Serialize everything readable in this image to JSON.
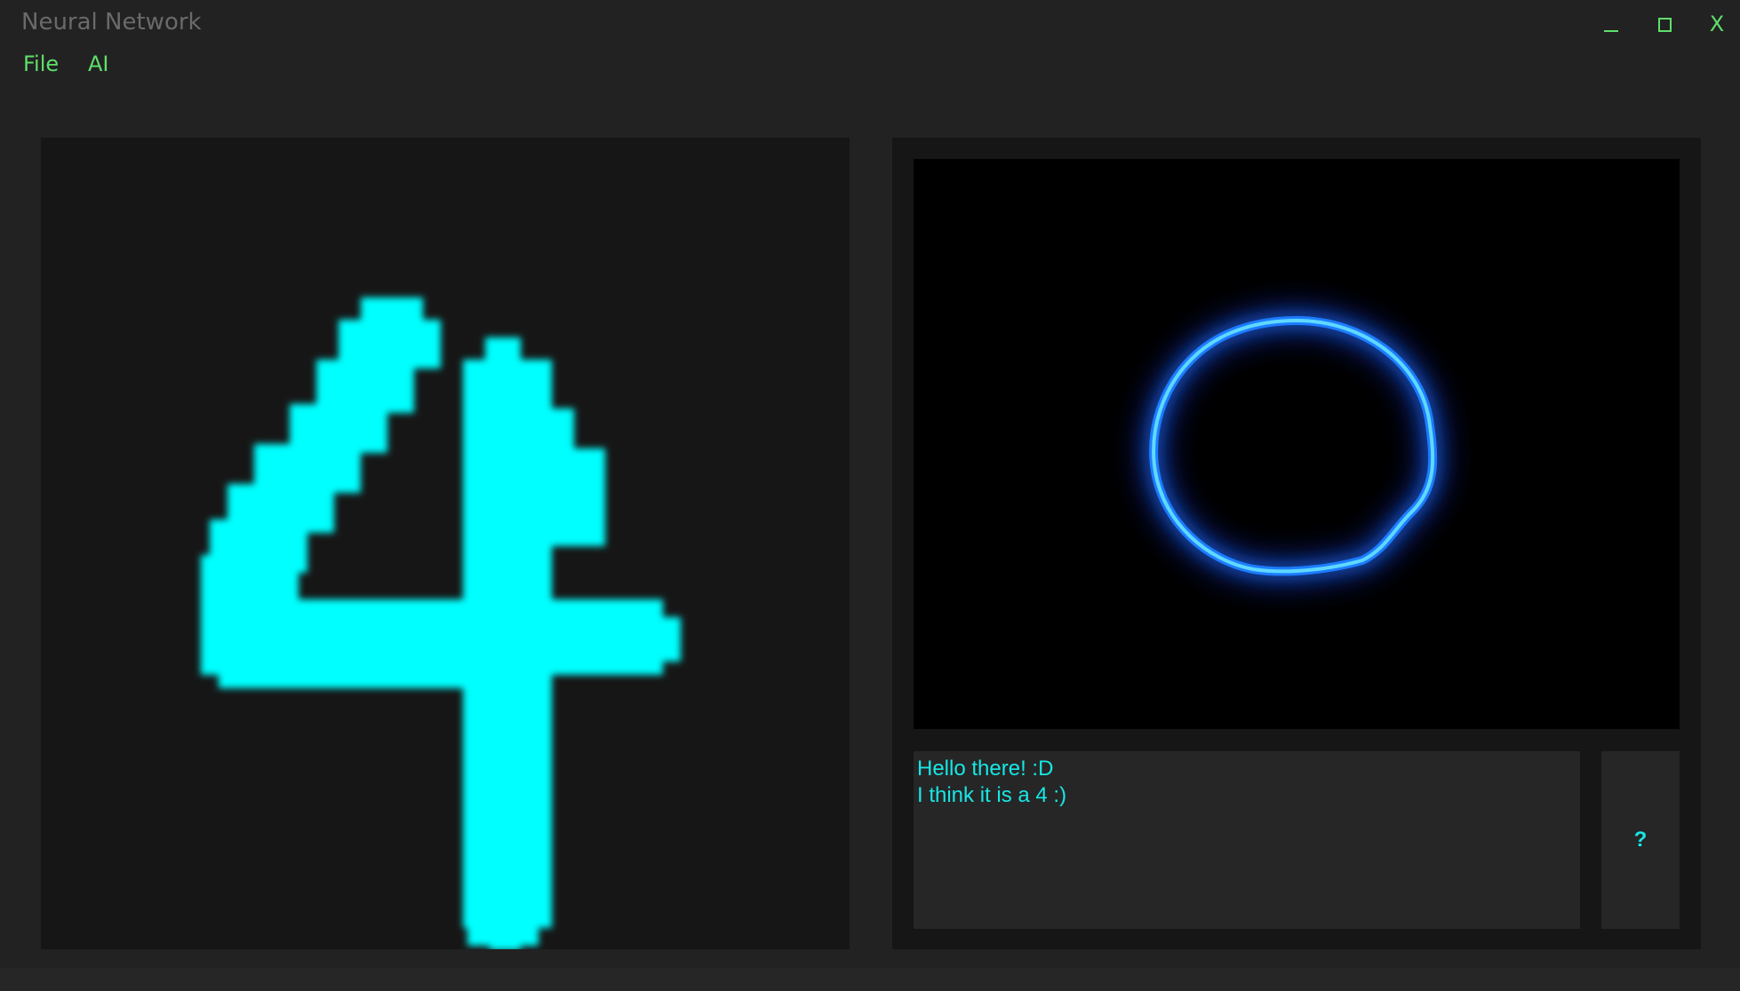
{
  "window": {
    "title": "Neural Network",
    "controls": {
      "minimize": "_",
      "maximize": "□",
      "close": "X"
    }
  },
  "menu": {
    "items": [
      {
        "label": "File"
      },
      {
        "label": "AI"
      }
    ]
  },
  "colors": {
    "background": "#222222",
    "panel": "#161616",
    "accent_green": "#5fdf6a",
    "digit": "#00ffff",
    "text_cyan": "#19e6e6",
    "ring_blue": "#1e90ff"
  },
  "canvas": {
    "drawn_digit": "4"
  },
  "visualizer": {
    "icon": "glowing-ring-icon"
  },
  "output": {
    "lines": [
      "Hello there! :D",
      "I think it is a 4 :)"
    ]
  },
  "help_button": {
    "label": "?"
  }
}
